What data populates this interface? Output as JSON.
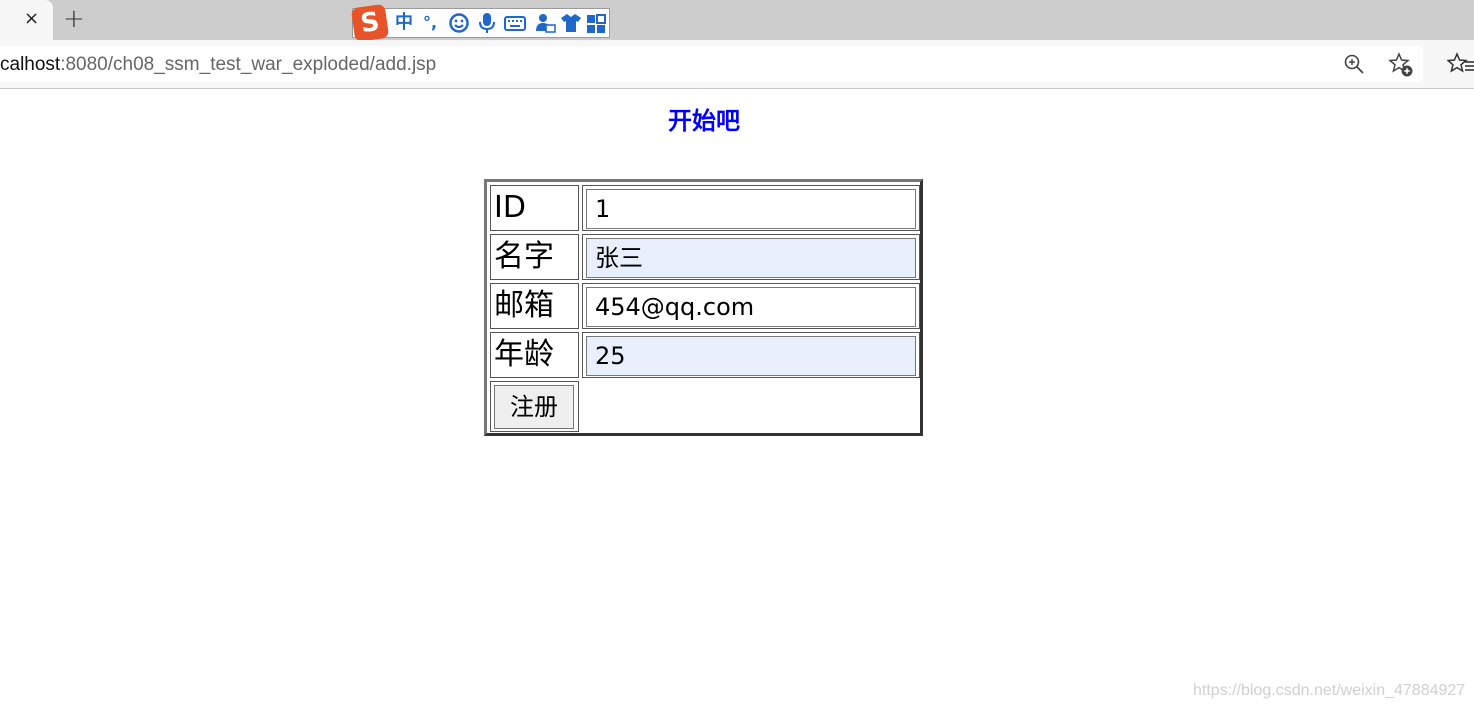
{
  "browser": {
    "tab_close_glyph": "×",
    "new_tab_glyph": "+",
    "url_host": "calhost",
    "url_rest": ":8080/ch08_ssm_test_war_exploded/add.jsp",
    "icons": [
      "close-icon",
      "plus-icon",
      "zoom-icon",
      "favorite-add-icon",
      "favorites-icon"
    ]
  },
  "ime": {
    "logo": "S",
    "mode": "中",
    "punct": "°,",
    "icons": [
      "emoji-icon",
      "mic-icon",
      "keyboard-icon",
      "user-icon",
      "skin-icon",
      "grid-icon"
    ]
  },
  "page": {
    "heading": "开始吧",
    "heading_color": "#0000ff"
  },
  "form": {
    "rows": [
      {
        "label": "ID",
        "value": "1"
      },
      {
        "label": "名字",
        "value": "张三"
      },
      {
        "label": "邮箱",
        "value": "454@qq.com"
      },
      {
        "label": "年龄",
        "value": "25"
      }
    ],
    "submit_label": "注册"
  },
  "watermark": "https://blog.csdn.net/weixin_47884927"
}
